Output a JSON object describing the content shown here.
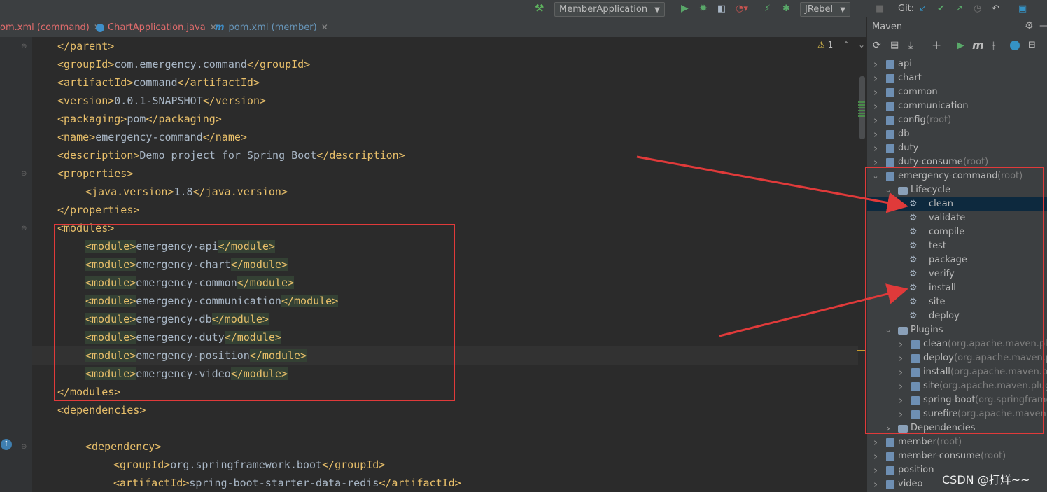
{
  "toolbar": {
    "run_config": "MemberApplication",
    "jrebel": "JRebel",
    "git_label": "Git:"
  },
  "tabs": [
    {
      "label": "om.xml (command)",
      "color": "#e06c6c",
      "icon": ""
    },
    {
      "label": "ChartApplication.java",
      "color": "#e06c6c",
      "icon": "java-class-icon"
    },
    {
      "label": "pom.xml (member)",
      "color": "#6897bb",
      "icon": "m"
    }
  ],
  "editor": {
    "warning_count": "1",
    "lines": [
      {
        "indent": 0,
        "tag": "</parent>"
      },
      {
        "indent": 0,
        "open": "<groupId>",
        "text": "com.emergency.command",
        "close": "</groupId>"
      },
      {
        "indent": 0,
        "open": "<artifactId>",
        "text": "command",
        "close": "</artifactId>"
      },
      {
        "indent": 0,
        "open": "<version>",
        "text": "0.0.1-SNAPSHOT",
        "close": "</version>"
      },
      {
        "indent": 0,
        "open": "<packaging>",
        "text": "pom",
        "close": "</packaging>"
      },
      {
        "indent": 0,
        "open": "<name>",
        "text": "emergency-command",
        "close": "</name>"
      },
      {
        "indent": 0,
        "open": "<description>",
        "text": "Demo project for Spring Boot",
        "close": "</description>"
      },
      {
        "indent": 0,
        "tag": "<properties>"
      },
      {
        "indent": 1,
        "open": "<java.version>",
        "text": "1.8",
        "close": "</java.version>"
      },
      {
        "indent": 0,
        "tag": "</properties>"
      },
      {
        "indent": 0,
        "tag": "<modules>"
      },
      {
        "indent": 1,
        "open": "<module>",
        "text": "emergency-api",
        "close": "</module>",
        "hl": true
      },
      {
        "indent": 1,
        "open": "<module>",
        "text": "emergency-chart",
        "close": "</module>",
        "hl": true
      },
      {
        "indent": 1,
        "open": "<module>",
        "text": "emergency-common",
        "close": "</module>",
        "hl": true
      },
      {
        "indent": 1,
        "open": "<module>",
        "text": "emergency-communication",
        "close": "</module>",
        "hl": true
      },
      {
        "indent": 1,
        "open": "<module>",
        "text": "emergency-db",
        "close": "</module>",
        "hl": true
      },
      {
        "indent": 1,
        "open": "<module>",
        "text": "emergency-duty",
        "close": "</module>",
        "hl": true
      },
      {
        "indent": 1,
        "open": "<module>",
        "text": "emergency-position",
        "close": "</module>",
        "hl": true
      },
      {
        "indent": 1,
        "open": "<module>",
        "text": "emergency-video",
        "close": "</module>",
        "hl": true
      },
      {
        "indent": 0,
        "tag": "</modules>"
      },
      {
        "indent": 0,
        "tag": "<dependencies>"
      },
      {
        "indent": 0,
        "tag": ""
      },
      {
        "indent": 1,
        "tag": "<dependency>"
      },
      {
        "indent": 2,
        "open": "<groupId>",
        "text": "org.springframework.boot",
        "close": "</groupId>"
      },
      {
        "indent": 2,
        "open": "<artifactId>",
        "text": "spring-boot-starter-data-redis",
        "close": "</artifactId>"
      }
    ]
  },
  "maven": {
    "title": "Maven",
    "tree": [
      {
        "level": 0,
        "kind": "module",
        "chev": "right",
        "label": "api",
        "suffix": ""
      },
      {
        "level": 0,
        "kind": "module",
        "chev": "right",
        "label": "chart",
        "suffix": ""
      },
      {
        "level": 0,
        "kind": "module",
        "chev": "right",
        "label": "common",
        "suffix": ""
      },
      {
        "level": 0,
        "kind": "module",
        "chev": "right",
        "label": "communication",
        "suffix": ""
      },
      {
        "level": 0,
        "kind": "module",
        "chev": "right",
        "label": "config",
        "suffix": " (root)"
      },
      {
        "level": 0,
        "kind": "module",
        "chev": "right",
        "label": "db",
        "suffix": ""
      },
      {
        "level": 0,
        "kind": "module",
        "chev": "right",
        "label": "duty",
        "suffix": ""
      },
      {
        "level": 0,
        "kind": "module",
        "chev": "right",
        "label": "duty-consume",
        "suffix": " (root)"
      },
      {
        "level": 0,
        "kind": "module",
        "chev": "down",
        "label": "emergency-command",
        "suffix": " (root)"
      },
      {
        "level": 1,
        "kind": "folder",
        "chev": "down",
        "label": "Lifecycle",
        "suffix": ""
      },
      {
        "level": 2,
        "kind": "goal",
        "chev": "",
        "label": "clean",
        "suffix": "",
        "selected": true
      },
      {
        "level": 2,
        "kind": "goal",
        "chev": "",
        "label": "validate",
        "suffix": ""
      },
      {
        "level": 2,
        "kind": "goal",
        "chev": "",
        "label": "compile",
        "suffix": ""
      },
      {
        "level": 2,
        "kind": "goal",
        "chev": "",
        "label": "test",
        "suffix": ""
      },
      {
        "level": 2,
        "kind": "goal",
        "chev": "",
        "label": "package",
        "suffix": ""
      },
      {
        "level": 2,
        "kind": "goal",
        "chev": "",
        "label": "verify",
        "suffix": ""
      },
      {
        "level": 2,
        "kind": "goal",
        "chev": "",
        "label": "install",
        "suffix": ""
      },
      {
        "level": 2,
        "kind": "goal",
        "chev": "",
        "label": "site",
        "suffix": ""
      },
      {
        "level": 2,
        "kind": "goal",
        "chev": "",
        "label": "deploy",
        "suffix": ""
      },
      {
        "level": 1,
        "kind": "folder",
        "chev": "down",
        "label": "Plugins",
        "suffix": ""
      },
      {
        "level": 2,
        "kind": "plugin",
        "chev": "right",
        "label": "clean",
        "suffix": " (org.apache.maven.plugi"
      },
      {
        "level": 2,
        "kind": "plugin",
        "chev": "right",
        "label": "deploy",
        "suffix": " (org.apache.maven.plu"
      },
      {
        "level": 2,
        "kind": "plugin",
        "chev": "right",
        "label": "install",
        "suffix": " (org.apache.maven.plug"
      },
      {
        "level": 2,
        "kind": "plugin",
        "chev": "right",
        "label": "site",
        "suffix": " (org.apache.maven.plugins"
      },
      {
        "level": 2,
        "kind": "plugin",
        "chev": "right",
        "label": "spring-boot",
        "suffix": " (org.springframev"
      },
      {
        "level": 2,
        "kind": "plugin",
        "chev": "right",
        "label": "surefire",
        "suffix": " (org.apache.maven.plu"
      },
      {
        "level": 1,
        "kind": "folder",
        "chev": "right",
        "label": "Dependencies",
        "suffix": ""
      },
      {
        "level": 0,
        "kind": "module",
        "chev": "right",
        "label": "member",
        "suffix": " (root)"
      },
      {
        "level": 0,
        "kind": "module",
        "chev": "right",
        "label": "member-consume",
        "suffix": " (root)"
      },
      {
        "level": 0,
        "kind": "module",
        "chev": "right",
        "label": "position",
        "suffix": ""
      },
      {
        "level": 0,
        "kind": "module",
        "chev": "right",
        "label": "video",
        "suffix": ""
      }
    ]
  },
  "watermark": "CSDN @打烊~~",
  "colors": {
    "tag": "#e8bf6a",
    "text": "#a9b7c6",
    "annotation": "#e03a3a",
    "selection": "#0d293e"
  }
}
